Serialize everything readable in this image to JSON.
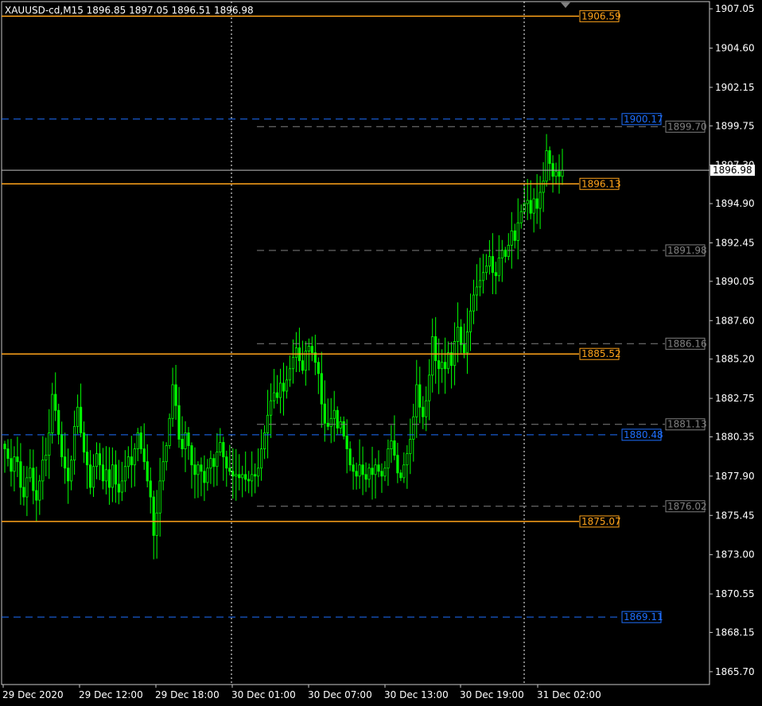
{
  "header": {
    "title": "XAUUSD-cd,M15  1896.85 1897.05 1896.51 1896.98"
  },
  "colors": {
    "background": "#000000",
    "frame": "#c8c8c8",
    "candle": "#00ff00",
    "orange_level": "#ffa31a",
    "blue_level": "#1e6fff",
    "gray_level": "#808080",
    "current_price": "#c0c0c0",
    "text": "#ffffff"
  },
  "chart_data": {
    "type": "candlestick",
    "symbol": "XAUUSD-cd",
    "timeframe": "M15",
    "ohlc_last": {
      "open": 1896.85,
      "high": 1897.05,
      "low": 1896.51,
      "close": 1896.98
    },
    "current_price": 1896.98,
    "y_ticks": [
      "1907.05",
      "1904.60",
      "1902.15",
      "1899.75",
      "1897.30",
      "1894.90",
      "1892.45",
      "1890.05",
      "1887.60",
      "1885.20",
      "1882.75",
      "1880.35",
      "1877.90",
      "1875.45",
      "1873.00",
      "1870.55",
      "1868.15",
      "1865.70"
    ],
    "ylim": [
      1864.9,
      1907.5
    ],
    "x_ticks": [
      "29 Dec 2020",
      "29 Dec 12:00",
      "29 Dec 18:00",
      "30 Dec 01:00",
      "30 Dec 07:00",
      "30 Dec 13:00",
      "30 Dec 19:00",
      "31 Dec 02:00"
    ],
    "period_separators": [
      "30 Dec 01:00",
      "31 Dec 02:00"
    ],
    "levels": [
      {
        "price": 1906.59,
        "label": "1906.59",
        "style": "orange-solid"
      },
      {
        "price": 1900.17,
        "label": "1900.17",
        "style": "blue-dashed"
      },
      {
        "price": 1899.7,
        "label": "1899.70",
        "style": "gray-dashed"
      },
      {
        "price": 1896.13,
        "label": "1896.13",
        "style": "orange-solid"
      },
      {
        "price": 1891.98,
        "label": "1891.98",
        "style": "gray-dashed"
      },
      {
        "price": 1886.16,
        "label": "1886.16",
        "style": "gray-dashed"
      },
      {
        "price": 1885.52,
        "label": "1885.52",
        "style": "orange-solid"
      },
      {
        "price": 1881.13,
        "label": "1881.13",
        "style": "gray-dashed"
      },
      {
        "price": 1880.48,
        "label": "1880.48",
        "style": "blue-dashed"
      },
      {
        "price": 1876.02,
        "label": "1876.02",
        "style": "gray-dashed"
      },
      {
        "price": 1875.07,
        "label": "1875.07",
        "style": "orange-solid"
      },
      {
        "price": 1869.11,
        "label": "1869.11",
        "style": "blue-dashed"
      }
    ],
    "close_path": [
      1879.6,
      1879.0,
      1878.2,
      1879.1,
      1878.8,
      1877.2,
      1876.6,
      1877.8,
      1878.4,
      1877.0,
      1876.4,
      1877.6,
      1878.9,
      1879.2,
      1880.6,
      1883.0,
      1882.0,
      1880.5,
      1879.1,
      1878.4,
      1877.6,
      1878.9,
      1881.0,
      1882.2,
      1880.6,
      1879.4,
      1878.6,
      1877.2,
      1878.5,
      1879.3,
      1878.6,
      1877.6,
      1878.3,
      1877.2,
      1878.6,
      1877.4,
      1876.9,
      1877.6,
      1878.5,
      1879.1,
      1878.6,
      1879.6,
      1880.6,
      1879.6,
      1878.8,
      1877.6,
      1876.6,
      1874.2,
      1875.6,
      1877.6,
      1878.8,
      1879.8,
      1881.5,
      1883.6,
      1882.3,
      1880.2,
      1879.6,
      1880.6,
      1879.8,
      1878.6,
      1878.0,
      1878.6,
      1878.2,
      1877.5,
      1878.4,
      1879.0,
      1878.5,
      1879.4,
      1880.0,
      1879.1,
      1878.4,
      1878.2,
      1877.9,
      1878.0,
      1877.8,
      1878.0,
      1877.7,
      1877.6,
      1878.0,
      1877.9,
      1878.4,
      1879.6,
      1880.6,
      1881.7,
      1882.6,
      1883.1,
      1882.8,
      1883.7,
      1883.2,
      1883.9,
      1884.6,
      1885.3,
      1885.9,
      1885.1,
      1884.5,
      1885.7,
      1886.0,
      1885.6,
      1885.0,
      1884.3,
      1882.4,
      1881.2,
      1881.0,
      1881.5,
      1882.0,
      1880.9,
      1881.3,
      1880.4,
      1879.6,
      1878.6,
      1878.2,
      1877.9,
      1878.6,
      1878.0,
      1877.7,
      1878.4,
      1878.0,
      1878.6,
      1878.2,
      1877.9,
      1878.4,
      1879.6,
      1880.1,
      1879.2,
      1878.1,
      1877.8,
      1878.6,
      1879.3,
      1880.2,
      1881.6,
      1883.6,
      1882.2,
      1881.6,
      1882.6,
      1884.2,
      1886.6,
      1885.1,
      1884.6,
      1885.0,
      1884.6,
      1885.6,
      1884.8,
      1886.3,
      1887.2,
      1886.1,
      1885.6,
      1886.9,
      1888.2,
      1889.2,
      1889.7,
      1890.1,
      1890.6,
      1891.0,
      1891.6,
      1890.6,
      1890.4,
      1891.5,
      1892.0,
      1891.6,
      1892.3,
      1893.2,
      1892.6,
      1893.7,
      1894.4,
      1894.9,
      1895.1,
      1894.3,
      1895.2,
      1894.6,
      1895.6,
      1896.3,
      1898.2,
      1897.4,
      1896.6,
      1896.9,
      1896.6,
      1896.98
    ]
  }
}
